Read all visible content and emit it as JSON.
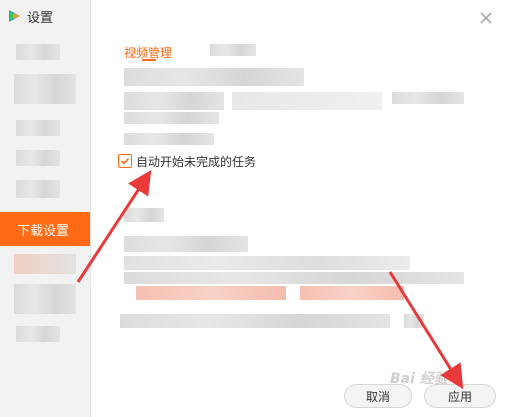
{
  "window": {
    "title": "设置"
  },
  "sidebar": {
    "active_item": "下载设置"
  },
  "content": {
    "tab_label": "视频管理",
    "checkbox": {
      "label": "自动开始未完成的任务",
      "checked": true
    }
  },
  "footer": {
    "cancel_label": "取消",
    "apply_label": "应用"
  },
  "watermark": "Bai 经验",
  "colors": {
    "accent": "#ff6a13",
    "annotation_arrow": "#e83a3a"
  },
  "icons": {
    "app_logo": "play-triangle-icon",
    "close": "close-icon",
    "check": "check-icon"
  }
}
